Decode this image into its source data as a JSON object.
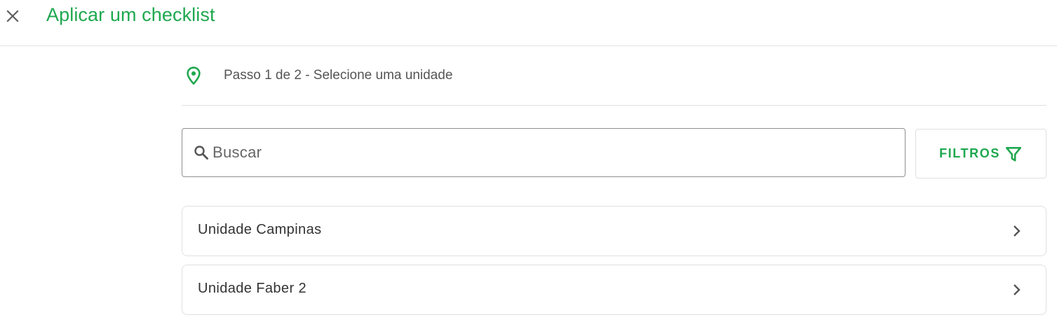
{
  "header": {
    "title": "Aplicar um checklist",
    "close_icon": "close-icon"
  },
  "step": {
    "icon": "location-pin-icon",
    "text": "Passo 1 de 2 - Selecione uma unidade"
  },
  "search": {
    "placeholder": "Buscar",
    "value": "",
    "icon": "search-icon"
  },
  "filters": {
    "label": "FILTROS",
    "icon": "filter-icon"
  },
  "units": [
    {
      "label": "Unidade Campinas"
    },
    {
      "label": "Unidade Faber 2"
    }
  ],
  "colors": {
    "accent": "#1fa84f",
    "text": "#333333",
    "muted": "#555555",
    "border": "#e0e0e0"
  }
}
